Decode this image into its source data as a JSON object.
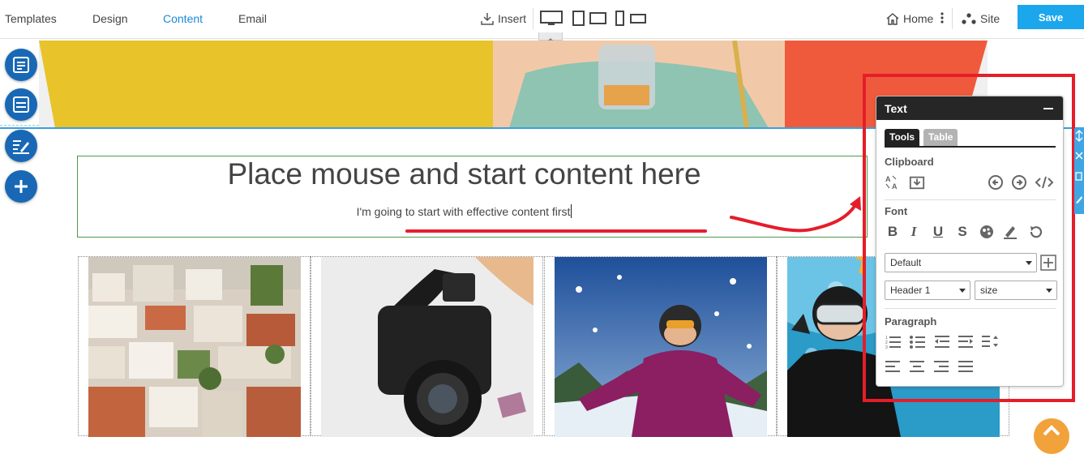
{
  "topbar": {
    "tabs": [
      {
        "label": "Templates"
      },
      {
        "label": "Design"
      },
      {
        "label": "Content"
      },
      {
        "label": "Email"
      }
    ],
    "active_tab": "Content",
    "insert_label": "Insert",
    "home_label": "Home",
    "site_label": "Site",
    "save_label": "Save",
    "accent_color": "#1ca6ec"
  },
  "canvas": {
    "headline": "Place mouse and start content here",
    "subline": "I'm going to start with effective content first"
  },
  "side_buttons": [
    "layout-icon",
    "rows-icon",
    "edit-text-icon",
    "plus-icon"
  ],
  "text_panel": {
    "title": "Text",
    "tabs": {
      "tools": "Tools",
      "table": "Table"
    },
    "clipboard_title": "Clipboard",
    "font_title": "Font",
    "font_icons": {
      "bold": "B",
      "italic": "I",
      "underline": "U",
      "strike": "S"
    },
    "font_family": "Default",
    "heading": "Header 1",
    "size_placeholder": "size",
    "paragraph_title": "Paragraph"
  },
  "annotation_color": "#e51d2a"
}
